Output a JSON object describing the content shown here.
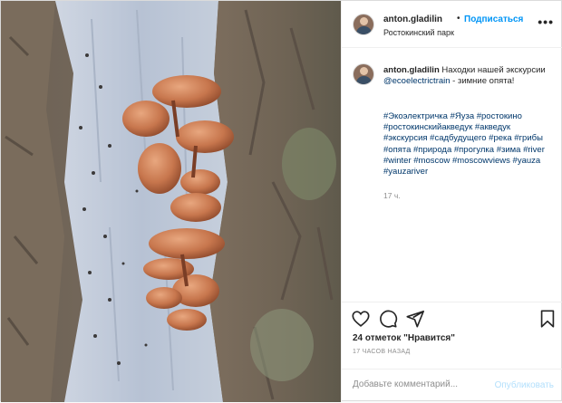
{
  "post": {
    "username": "anton.gladilin",
    "separator": "•",
    "follow_label": "Подписаться",
    "location": "Ростокинский парк",
    "more_icon": "more-dots-icon",
    "more_label": "•••"
  },
  "caption": {
    "username": "anton.gladilin",
    "text_before": "Находки нашей экскурсии ",
    "mention": "@ecoelectrictrain",
    "text_after": " - зимние опята!",
    "hashtags": "#Экоэлектричка #Яуза #ростокино #ростокинскийакведук #акведук #экскурсия #садбудущего #река #грибы #опята #природа #прогулка #зима #river #winter #moscow #moscowviews #yauza #yauzariver",
    "time_ago": "17 ч."
  },
  "actions": {
    "likes": "24 отметок \"Нравится\"",
    "posted": "17 ЧАСОВ НАЗАД",
    "comment_placeholder": "Добавьте комментарий...",
    "publish_label": "Опубликовать"
  },
  "colors": {
    "link": "#0095f6",
    "hashtag": "#00376b",
    "muted": "#8e8e8e",
    "publish_disabled": "#b2dffc"
  }
}
